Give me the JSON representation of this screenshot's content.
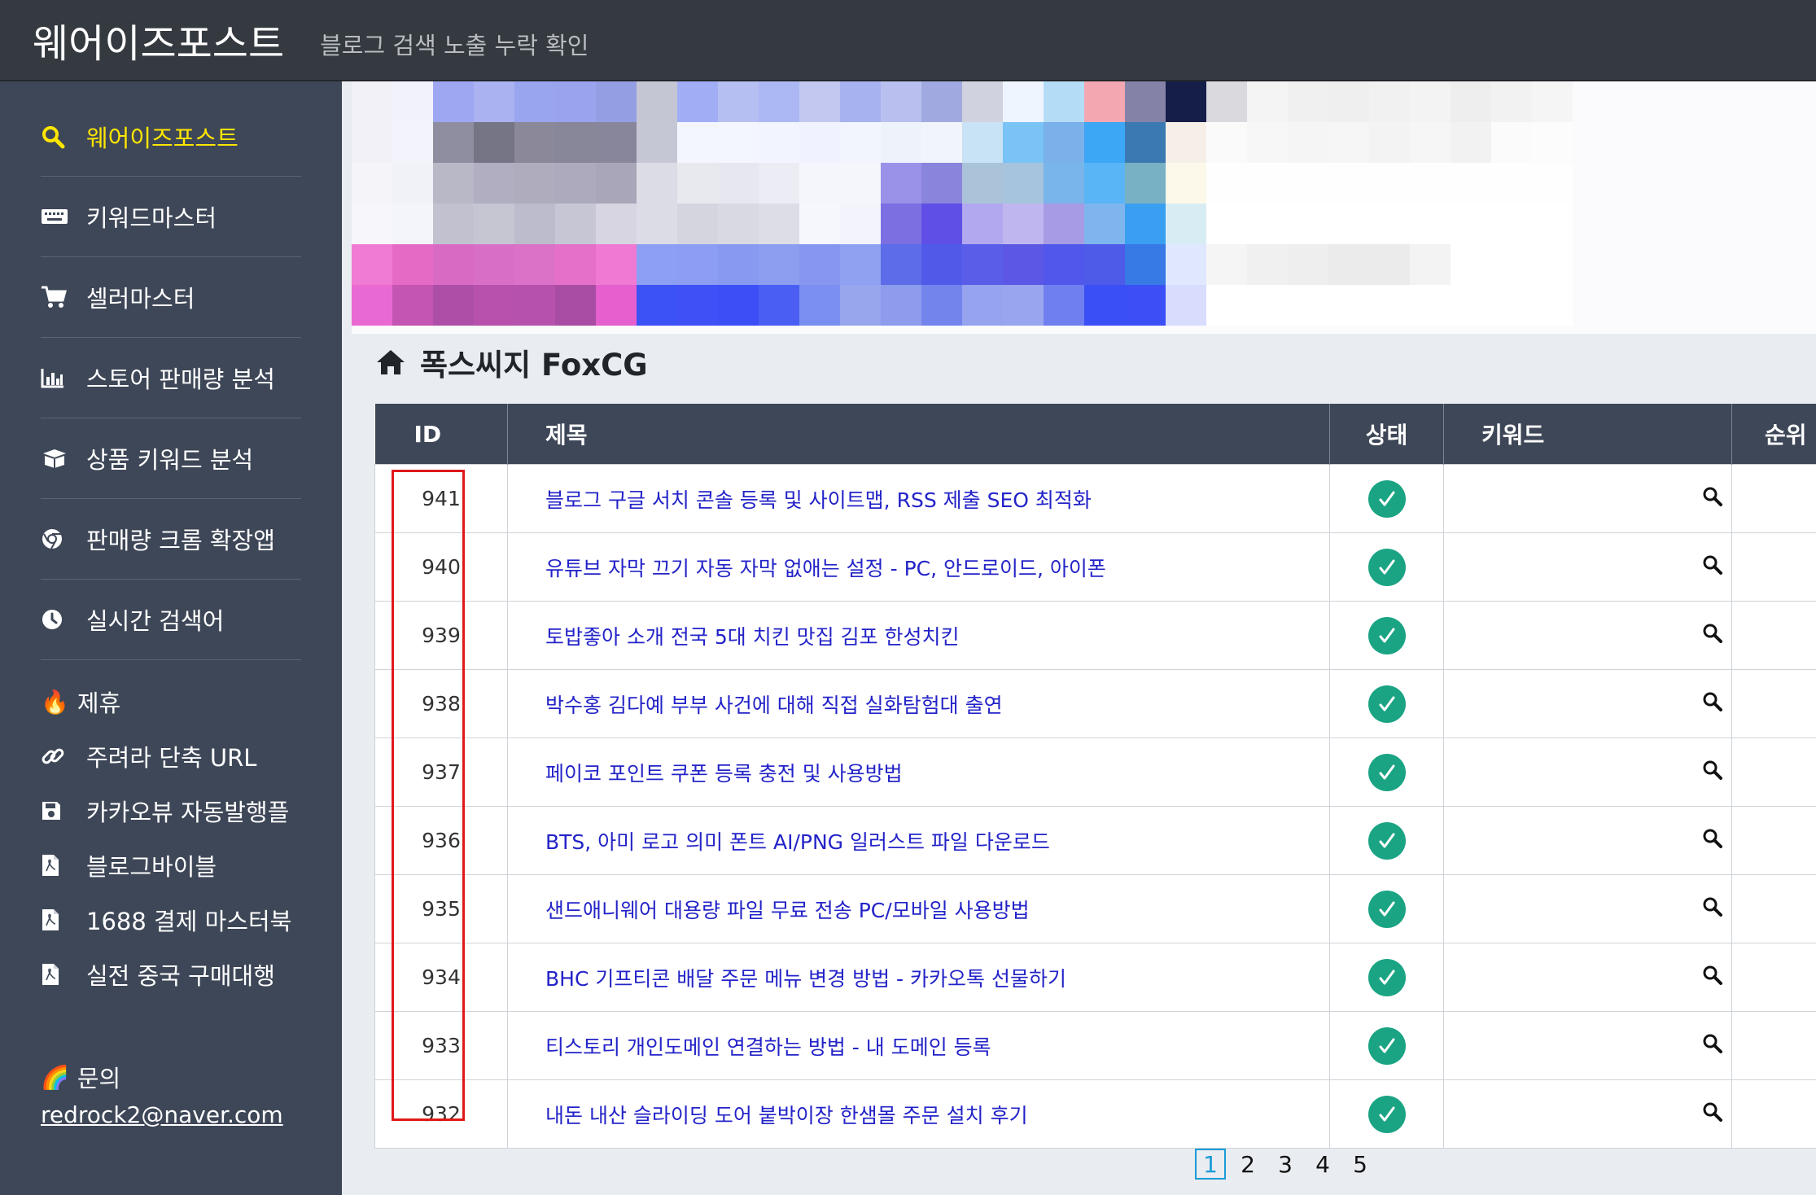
{
  "header": {
    "brand": "웨어이즈포스트",
    "subtitle": "블로그 검색 노출 누락 확인"
  },
  "sidebar": {
    "items": [
      {
        "label": "웨어이즈포스트",
        "icon": "search-icon",
        "active": true
      },
      {
        "label": "키워드마스터",
        "icon": "keyboard-icon"
      },
      {
        "label": "셀러마스터",
        "icon": "cart-icon"
      },
      {
        "label": "스토어 판매량 분석",
        "icon": "bar-chart-icon"
      },
      {
        "label": "상품 키워드 분석",
        "icon": "box-icon"
      },
      {
        "label": "판매량 크롬 확장앱",
        "icon": "chrome-icon"
      },
      {
        "label": "실시간 검색어",
        "icon": "clock-icon"
      }
    ],
    "partner_label": "제휴",
    "partner_emoji": "🔥",
    "partners": [
      {
        "label": "주려라 단축 URL",
        "icon": "link-icon"
      },
      {
        "label": "카카오뷰 자동발행플",
        "icon": "save-icon"
      },
      {
        "label": "블로그바이블",
        "icon": "pdf-file-icon"
      },
      {
        "label": "1688 결제 마스터북",
        "icon": "pdf-file-icon"
      },
      {
        "label": "실전 중국 구매대행",
        "icon": "pdf-file-icon"
      }
    ],
    "contact_label": "문의",
    "contact_emoji": "🌈",
    "contact_email": "redrock2@naver.com"
  },
  "main": {
    "blog_title": "폭스씨지 FoxCG",
    "table": {
      "headers": [
        "ID",
        "제목",
        "상태",
        "키워드",
        "순위"
      ],
      "rows": [
        {
          "id": "941",
          "title": "블로그 구글 서치 콘솔 등록 및 사이트맵, RSS 제출 SEO 최적화"
        },
        {
          "id": "940",
          "title": "유튜브 자막 끄기 자동 자막 없애는 설정 - PC, 안드로이드, 아이폰"
        },
        {
          "id": "939",
          "title": "토밥좋아 소개 전국 5대 치킨 맛집 김포 한성치킨"
        },
        {
          "id": "938",
          "title": "박수홍 김다예 부부 사건에 대해 직접 실화탐험대 출연"
        },
        {
          "id": "937",
          "title": "페이코 포인트 쿠폰 등록 충전 및 사용방법"
        },
        {
          "id": "936",
          "title": "BTS, 아미 로고 의미 폰트 AI/PNG 일러스트 파일 다운로드"
        },
        {
          "id": "935",
          "title": "샌드애니웨어 대용량 파일 무료 전송 PC/모바일 사용방법"
        },
        {
          "id": "934",
          "title": "BHC 기프티콘 배달 주문 메뉴 변경 방법 - 카카오톡 선물하기"
        },
        {
          "id": "933",
          "title": "티스토리 개인도메인 연결하는 방법 - 내 도메인 등록"
        },
        {
          "id": "932",
          "title": "내돈 내산 슬라이딩 도어 붙박이장 한샘몰 주문 설치 후기"
        }
      ]
    },
    "pagination": {
      "pages": [
        "1",
        "2",
        "3",
        "4",
        "5"
      ],
      "current": "1"
    }
  },
  "colors": {
    "topbar": "#343a40",
    "sidebar": "#3e4757",
    "active_nav": "#ffe600",
    "table_header": "#3e4757",
    "link": "#2323c8",
    "status_ok": "#1aa483",
    "highlight_box": "#e01818",
    "pager_active": "#1a9bd6"
  }
}
